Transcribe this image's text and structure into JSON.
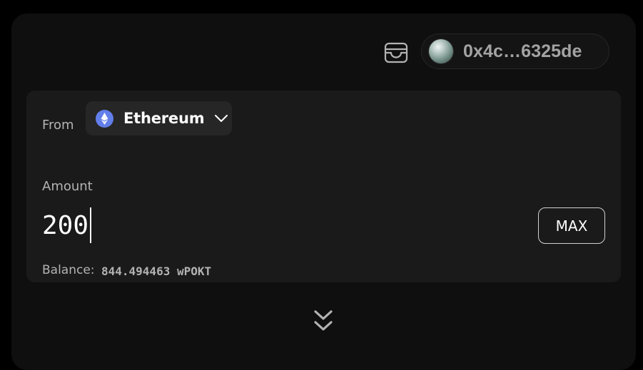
{
  "header": {
    "wallet_icon": "wallet-icon",
    "account": {
      "avatar_icon": "gradient-orb-avatar",
      "address": "0x4c…6325de"
    }
  },
  "from": {
    "label": "From",
    "chain": {
      "icon": "ethereum-icon",
      "name": "Ethereum",
      "dropdown_icon": "chevron-down-icon"
    }
  },
  "amount": {
    "label": "Amount",
    "value": "200",
    "max_label": "MAX"
  },
  "balance": {
    "label": "Balance:",
    "value": "844.494463 wPOKT"
  },
  "swap_direction_icon": "double-chevron-down-icon",
  "colors": {
    "background": "#000000",
    "panel": "#0f0f0f",
    "card": "#1a1a1a",
    "selector": "#262626",
    "text_primary": "#ffffff",
    "text_secondary": "#b3b3b3",
    "ethereum_accent": "#627eea"
  }
}
